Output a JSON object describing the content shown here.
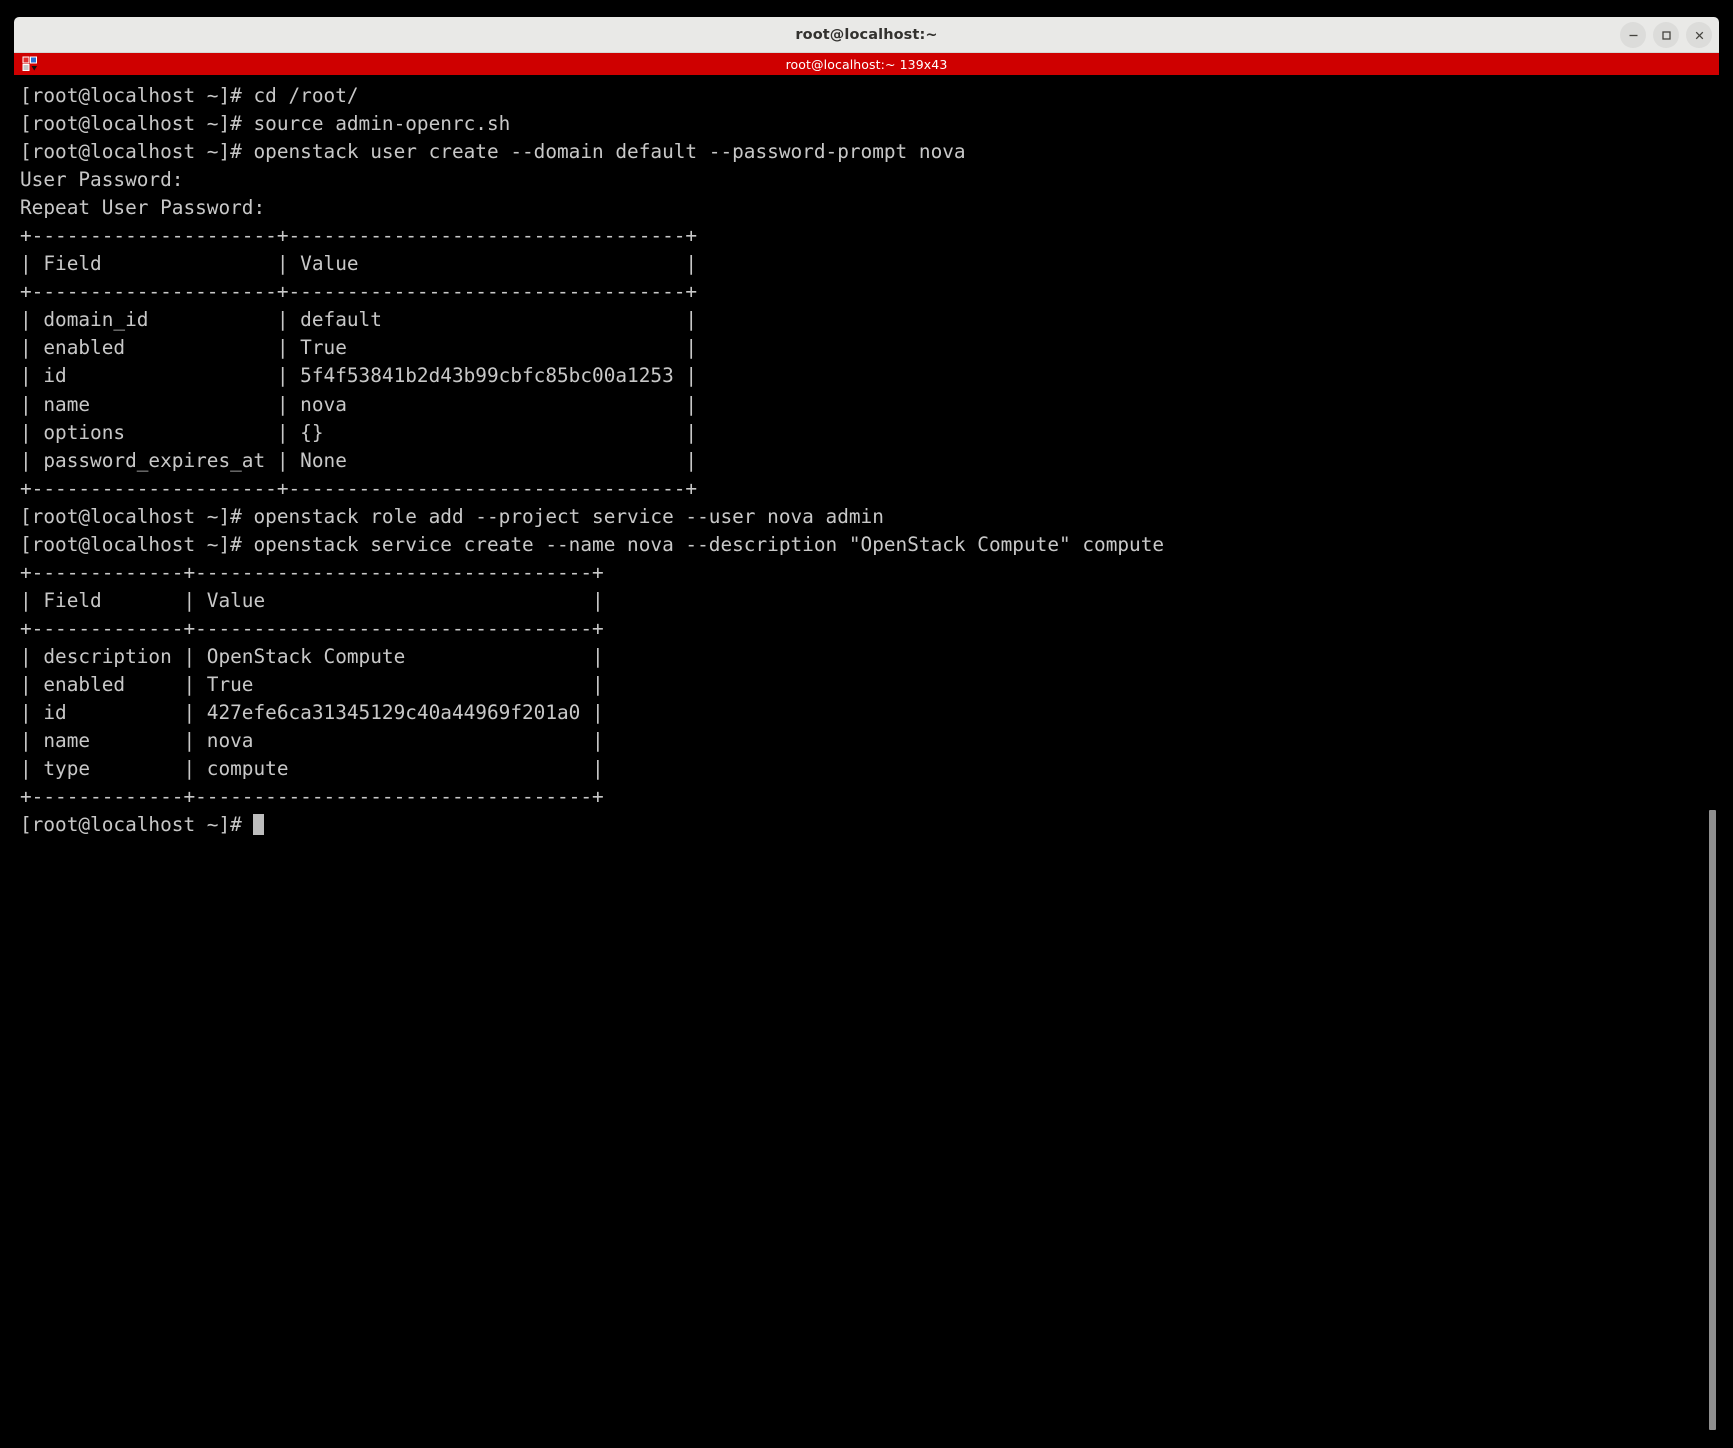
{
  "window": {
    "title": "root@localhost:~",
    "controls": {
      "minimize_label": "Minimize",
      "maximize_label": "Maximize",
      "close_label": "Close"
    }
  },
  "tab": {
    "label": "root@localhost:~ 139x43",
    "icon": "terminal-tabs-icon",
    "bar_color": "#cf0000"
  },
  "terminal": {
    "foreground_color": "#c8c8c8",
    "background_color": "#000000",
    "prompt": "[root@localhost ~]#",
    "lines": [
      "[root@localhost ~]# cd /root/",
      "[root@localhost ~]# source admin-openrc.sh",
      "[root@localhost ~]# openstack user create --domain default --password-prompt nova",
      "User Password:",
      "Repeat User Password:",
      "+---------------------+----------------------------------+",
      "| Field               | Value                            |",
      "+---------------------+----------------------------------+",
      "| domain_id           | default                          |",
      "| enabled             | True                             |",
      "| id                  | 5f4f53841b2d43b99cbfc85bc00a1253 |",
      "| name                | nova                             |",
      "| options             | {}                               |",
      "| password_expires_at | None                             |",
      "+---------------------+----------------------------------+",
      "[root@localhost ~]# openstack role add --project service --user nova admin",
      "[root@localhost ~]# openstack service create --name nova --description \"OpenStack Compute\" compute",
      "+-------------+----------------------------------+",
      "| Field       | Value                            |",
      "+-------------+----------------------------------+",
      "| description | OpenStack Compute                |",
      "| enabled     | True                             |",
      "| id          | 427efe6ca31345129c40a44969f201a0 |",
      "| name        | nova                             |",
      "| type        | compute                          |",
      "+-------------+----------------------------------+"
    ],
    "final_prompt": "[root@localhost ~]# ",
    "commands": [
      "cd /root/",
      "source admin-openrc.sh",
      "openstack user create --domain default --password-prompt nova",
      "openstack role add --project service --user nova admin",
      "openstack service create --name nova --description \"OpenStack Compute\" compute"
    ],
    "user_table": {
      "headers": [
        "Field",
        "Value"
      ],
      "rows": [
        [
          "domain_id",
          "default"
        ],
        [
          "enabled",
          "True"
        ],
        [
          "id",
          "5f4f53841b2d43b99cbfc85bc00a1253"
        ],
        [
          "name",
          "nova"
        ],
        [
          "options",
          "{}"
        ],
        [
          "password_expires_at",
          "None"
        ]
      ]
    },
    "service_table": {
      "headers": [
        "Field",
        "Value"
      ],
      "rows": [
        [
          "description",
          "OpenStack Compute"
        ],
        [
          "enabled",
          "True"
        ],
        [
          "id",
          "427efe6ca31345129c40a44969f201a0"
        ],
        [
          "name",
          "nova"
        ],
        [
          "type",
          "compute"
        ]
      ]
    },
    "password_prompts": [
      "User Password:",
      "Repeat User Password:"
    ]
  }
}
